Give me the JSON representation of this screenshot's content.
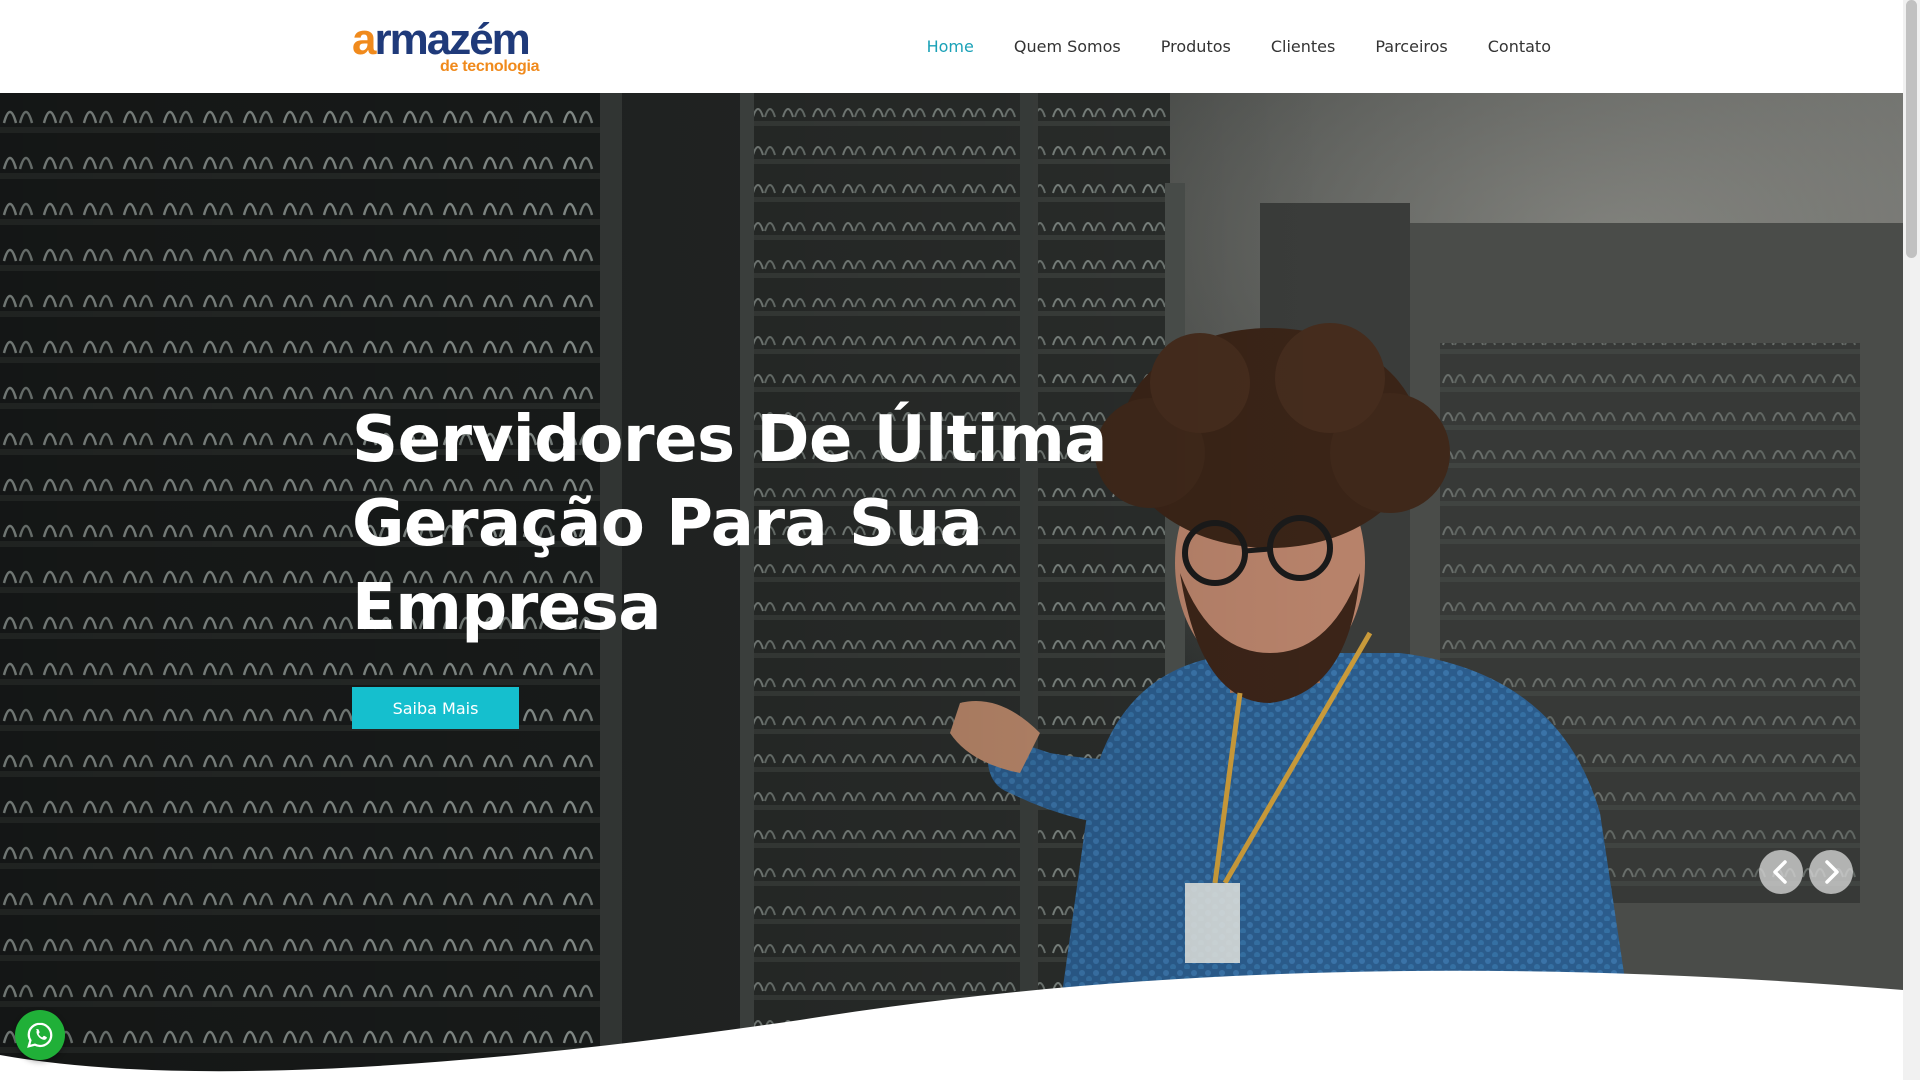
{
  "logo": {
    "first_letter": "a",
    "rest": "rmazém",
    "subtitle": "de tecnologia"
  },
  "nav": {
    "items": [
      {
        "label": "Home",
        "active": true
      },
      {
        "label": "Quem Somos",
        "active": false
      },
      {
        "label": "Produtos",
        "active": false
      },
      {
        "label": "Clientes",
        "active": false
      },
      {
        "label": "Parceiros",
        "active": false
      },
      {
        "label": "Contato",
        "active": false
      }
    ]
  },
  "hero": {
    "title": "Servidores De Última Geração Para Sua Empresa",
    "button_label": "Saiba Mais",
    "prev_icon": "chevron-left-icon",
    "next_icon": "chevron-right-icon"
  },
  "floating": {
    "whatsapp_icon": "whatsapp-icon"
  },
  "colors": {
    "brand_orange": "#f08a1c",
    "brand_blue": "#1f3a7a",
    "nav_active": "#1aa1b7",
    "cta": "#15bfce",
    "whatsapp": "#20b038"
  }
}
